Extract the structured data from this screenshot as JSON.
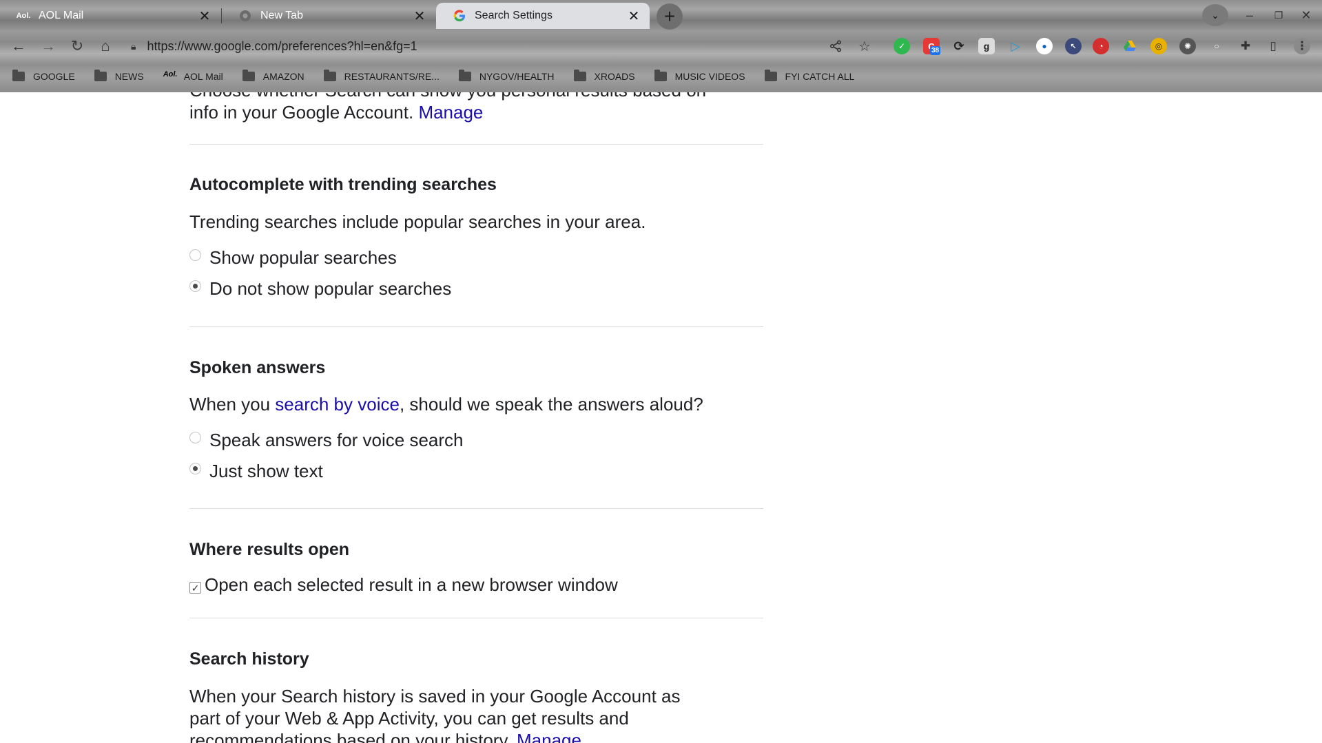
{
  "tabs": [
    {
      "title": "AOL Mail",
      "favicon": "aol-icon"
    },
    {
      "title": "New Tab",
      "favicon": "chrome-icon"
    },
    {
      "title": "Search Settings",
      "favicon": "google-icon",
      "active": true
    }
  ],
  "omnibox": {
    "url": "https://www.google.com/preferences?hl=en&fg=1"
  },
  "extensions": {
    "badge_count": "38"
  },
  "bookmarks": [
    {
      "label": "GOOGLE",
      "icon": "folder-icon"
    },
    {
      "label": "NEWS",
      "icon": "folder-icon"
    },
    {
      "label": "AOL Mail",
      "icon": "aol-icon"
    },
    {
      "label": "AMAZON",
      "icon": "folder-icon"
    },
    {
      "label": "RESTAURANTS/RE...",
      "icon": "folder-icon"
    },
    {
      "label": "NYGOV/HEALTH",
      "icon": "folder-icon"
    },
    {
      "label": "XROADS",
      "icon": "folder-icon"
    },
    {
      "label": "MUSIC VIDEOS",
      "icon": "folder-icon"
    },
    {
      "label": "FYI CATCH ALL",
      "icon": "folder-icon"
    }
  ],
  "page": {
    "personal": {
      "text_line1": "Choose whether Search can show you personal results based on",
      "text_line2": "info in your Google Account.",
      "manage_link": "Manage"
    },
    "autocomplete": {
      "heading": "Autocomplete with trending searches",
      "description": "Trending searches include popular searches in your area.",
      "options": [
        {
          "label": "Show popular searches",
          "checked": false
        },
        {
          "label": "Do not show popular searches",
          "checked": true
        }
      ]
    },
    "spoken": {
      "heading": "Spoken answers",
      "desc_prefix": "When you ",
      "desc_link": "search by voice",
      "desc_suffix": ", should we speak the answers aloud?",
      "options": [
        {
          "label": "Speak answers for voice search",
          "checked": false
        },
        {
          "label": "Just show text",
          "checked": true
        }
      ]
    },
    "results_open": {
      "heading": "Where results open",
      "checkbox_label": "Open each selected result in a new browser window",
      "checked": true
    },
    "history": {
      "heading": "Search history",
      "line1": "When your Search history is saved in your Google Account as",
      "line2": "part of your Web & App Activity, you can get results and",
      "line3": "recommendations based on your history.",
      "manage_link": "Manage"
    }
  }
}
